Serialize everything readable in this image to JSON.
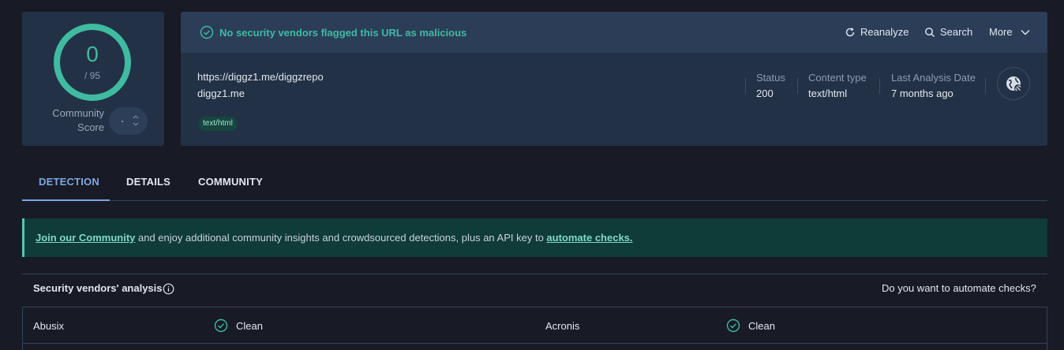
{
  "score": {
    "detections": "0",
    "total": "/ 95",
    "community_label": "Community Score"
  },
  "banner": {
    "message": "No security vendors flagged this URL as malicious",
    "actions": {
      "reanalyze": "Reanalyze",
      "search": "Search",
      "more": "More"
    }
  },
  "target": {
    "url": "https://diggz1.me/diggzrepo",
    "domain": "diggz1.me",
    "tag": "text/html"
  },
  "meta": [
    {
      "label": "Status",
      "value": "200"
    },
    {
      "label": "Content type",
      "value": "text/html"
    },
    {
      "label": "Last Analysis Date",
      "value": "7 months ago"
    }
  ],
  "tabs": [
    {
      "label": "DETECTION",
      "active": true
    },
    {
      "label": "DETAILS",
      "active": false
    },
    {
      "label": "COMMUNITY",
      "active": false
    }
  ],
  "promo": {
    "link1": "Join our Community",
    "middle": " and enjoy additional community insights and crowdsourced detections, plus an API key to ",
    "link2": "automate checks."
  },
  "vendors": {
    "title": "Security vendors' analysis",
    "automate_question": "Do you want to automate checks?",
    "rows": [
      [
        {
          "name": "Abusix",
          "result": "Clean"
        },
        {
          "name": "Acronis",
          "result": "Clean"
        }
      ]
    ]
  },
  "colors": {
    "background": "#181a26",
    "card": "#233146",
    "accent_green": "#3fbba1",
    "tab_active": "#7ea7e0",
    "promo_bg": "#0f3b38"
  },
  "icons": [
    "check-circle-icon",
    "reanalyze-icon",
    "search-icon",
    "chevron-down-icon",
    "globe-link-icon",
    "info-icon"
  ]
}
